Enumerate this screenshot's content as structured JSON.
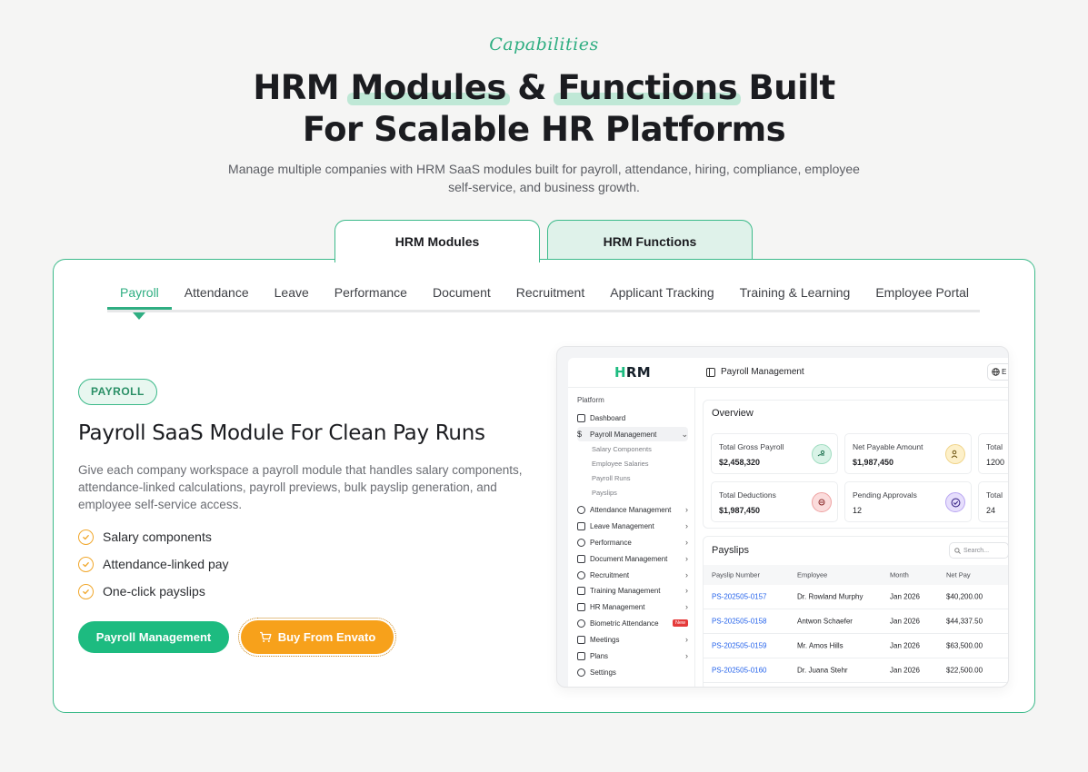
{
  "header": {
    "eyebrow": "Capabilities",
    "title_part1": "HRM",
    "title_hl1": "Modules",
    "title_amp": "&",
    "title_hl2": "Functions",
    "title_part2": "Built",
    "title_line2": "For Scalable HR Platforms",
    "subtitle": "Manage multiple companies with HRM SaaS modules built for payroll, attendance, hiring, compliance, employee self-service, and business growth."
  },
  "top_tabs": [
    {
      "label": "HRM Modules",
      "active": true
    },
    {
      "label": "HRM Functions",
      "active": false
    }
  ],
  "sub_tabs": [
    "Payroll",
    "Attendance",
    "Leave",
    "Performance",
    "Document",
    "Recruitment",
    "Applicant Tracking",
    "Training & Learning",
    "Employee Portal"
  ],
  "module": {
    "badge": "PAYROLL",
    "title": "Payroll SaaS Module For Clean Pay Runs",
    "description": "Give each company workspace a payroll module that handles salary components, attendance-linked calculations, payroll previews, bulk payslip generation, and employee self-service access.",
    "features": [
      "Salary components",
      "Attendance-linked pay",
      "One-click payslips"
    ],
    "primary_button": "Payroll Management",
    "secondary_button": "Buy From Envato"
  },
  "mock_app": {
    "logo_h": "H",
    "logo_rest": "RM",
    "page_title": "Payroll Management",
    "lang": "E",
    "sidebar_heading": "Platform",
    "sidebar": [
      {
        "label": "Dashboard"
      },
      {
        "label": "Payroll Management"
      },
      {
        "label": "Attendance Management"
      },
      {
        "label": "Leave Management"
      },
      {
        "label": "Performance"
      },
      {
        "label": "Document Management"
      },
      {
        "label": "Recruitment"
      },
      {
        "label": "Training Management"
      },
      {
        "label": "HR Management"
      },
      {
        "label": "Biometric Attendance"
      },
      {
        "label": "Meetings"
      },
      {
        "label": "Plans"
      },
      {
        "label": "Settings"
      }
    ],
    "sub_items": [
      "Salary Components",
      "Employee Salaries",
      "Payroll Runs",
      "Payslips"
    ],
    "new_tag": "New",
    "overview_title": "Overview",
    "stats": [
      {
        "label": "Total Gross Payroll",
        "value": "$2,458,320",
        "color": "#d9f3e7"
      },
      {
        "label": "Net Payable Amount",
        "value": "$1,987,450",
        "color": "#fdf0c9"
      },
      {
        "label": "Total",
        "value": "1200",
        "color": "#ffffff"
      },
      {
        "label": "Total Deductions",
        "value": "$1,987,450",
        "color": "#fbdcdc"
      },
      {
        "label": "Pending Approvals",
        "value": "12",
        "color": "#e6defc"
      },
      {
        "label": "Total",
        "value": "24",
        "color": "#ffffff"
      }
    ],
    "payslips_title": "Payslips",
    "search_placeholder": "Search...",
    "columns": [
      "Payslip Number",
      "Employee",
      "Month",
      "Net Pay"
    ],
    "rows": [
      [
        "PS-202505-0157",
        "Dr. Rowland Murphy",
        "Jan 2026",
        "$40,200.00"
      ],
      [
        "PS-202505-0158",
        "Antwon Schaefer",
        "Jan 2026",
        "$44,337.50"
      ],
      [
        "PS-202505-0159",
        "Mr. Amos Hills",
        "Jan 2026",
        "$63,500.00"
      ],
      [
        "PS-202505-0160",
        "Dr. Juana Stehr",
        "Jan 2026",
        "$22,500.00"
      ]
    ]
  }
}
